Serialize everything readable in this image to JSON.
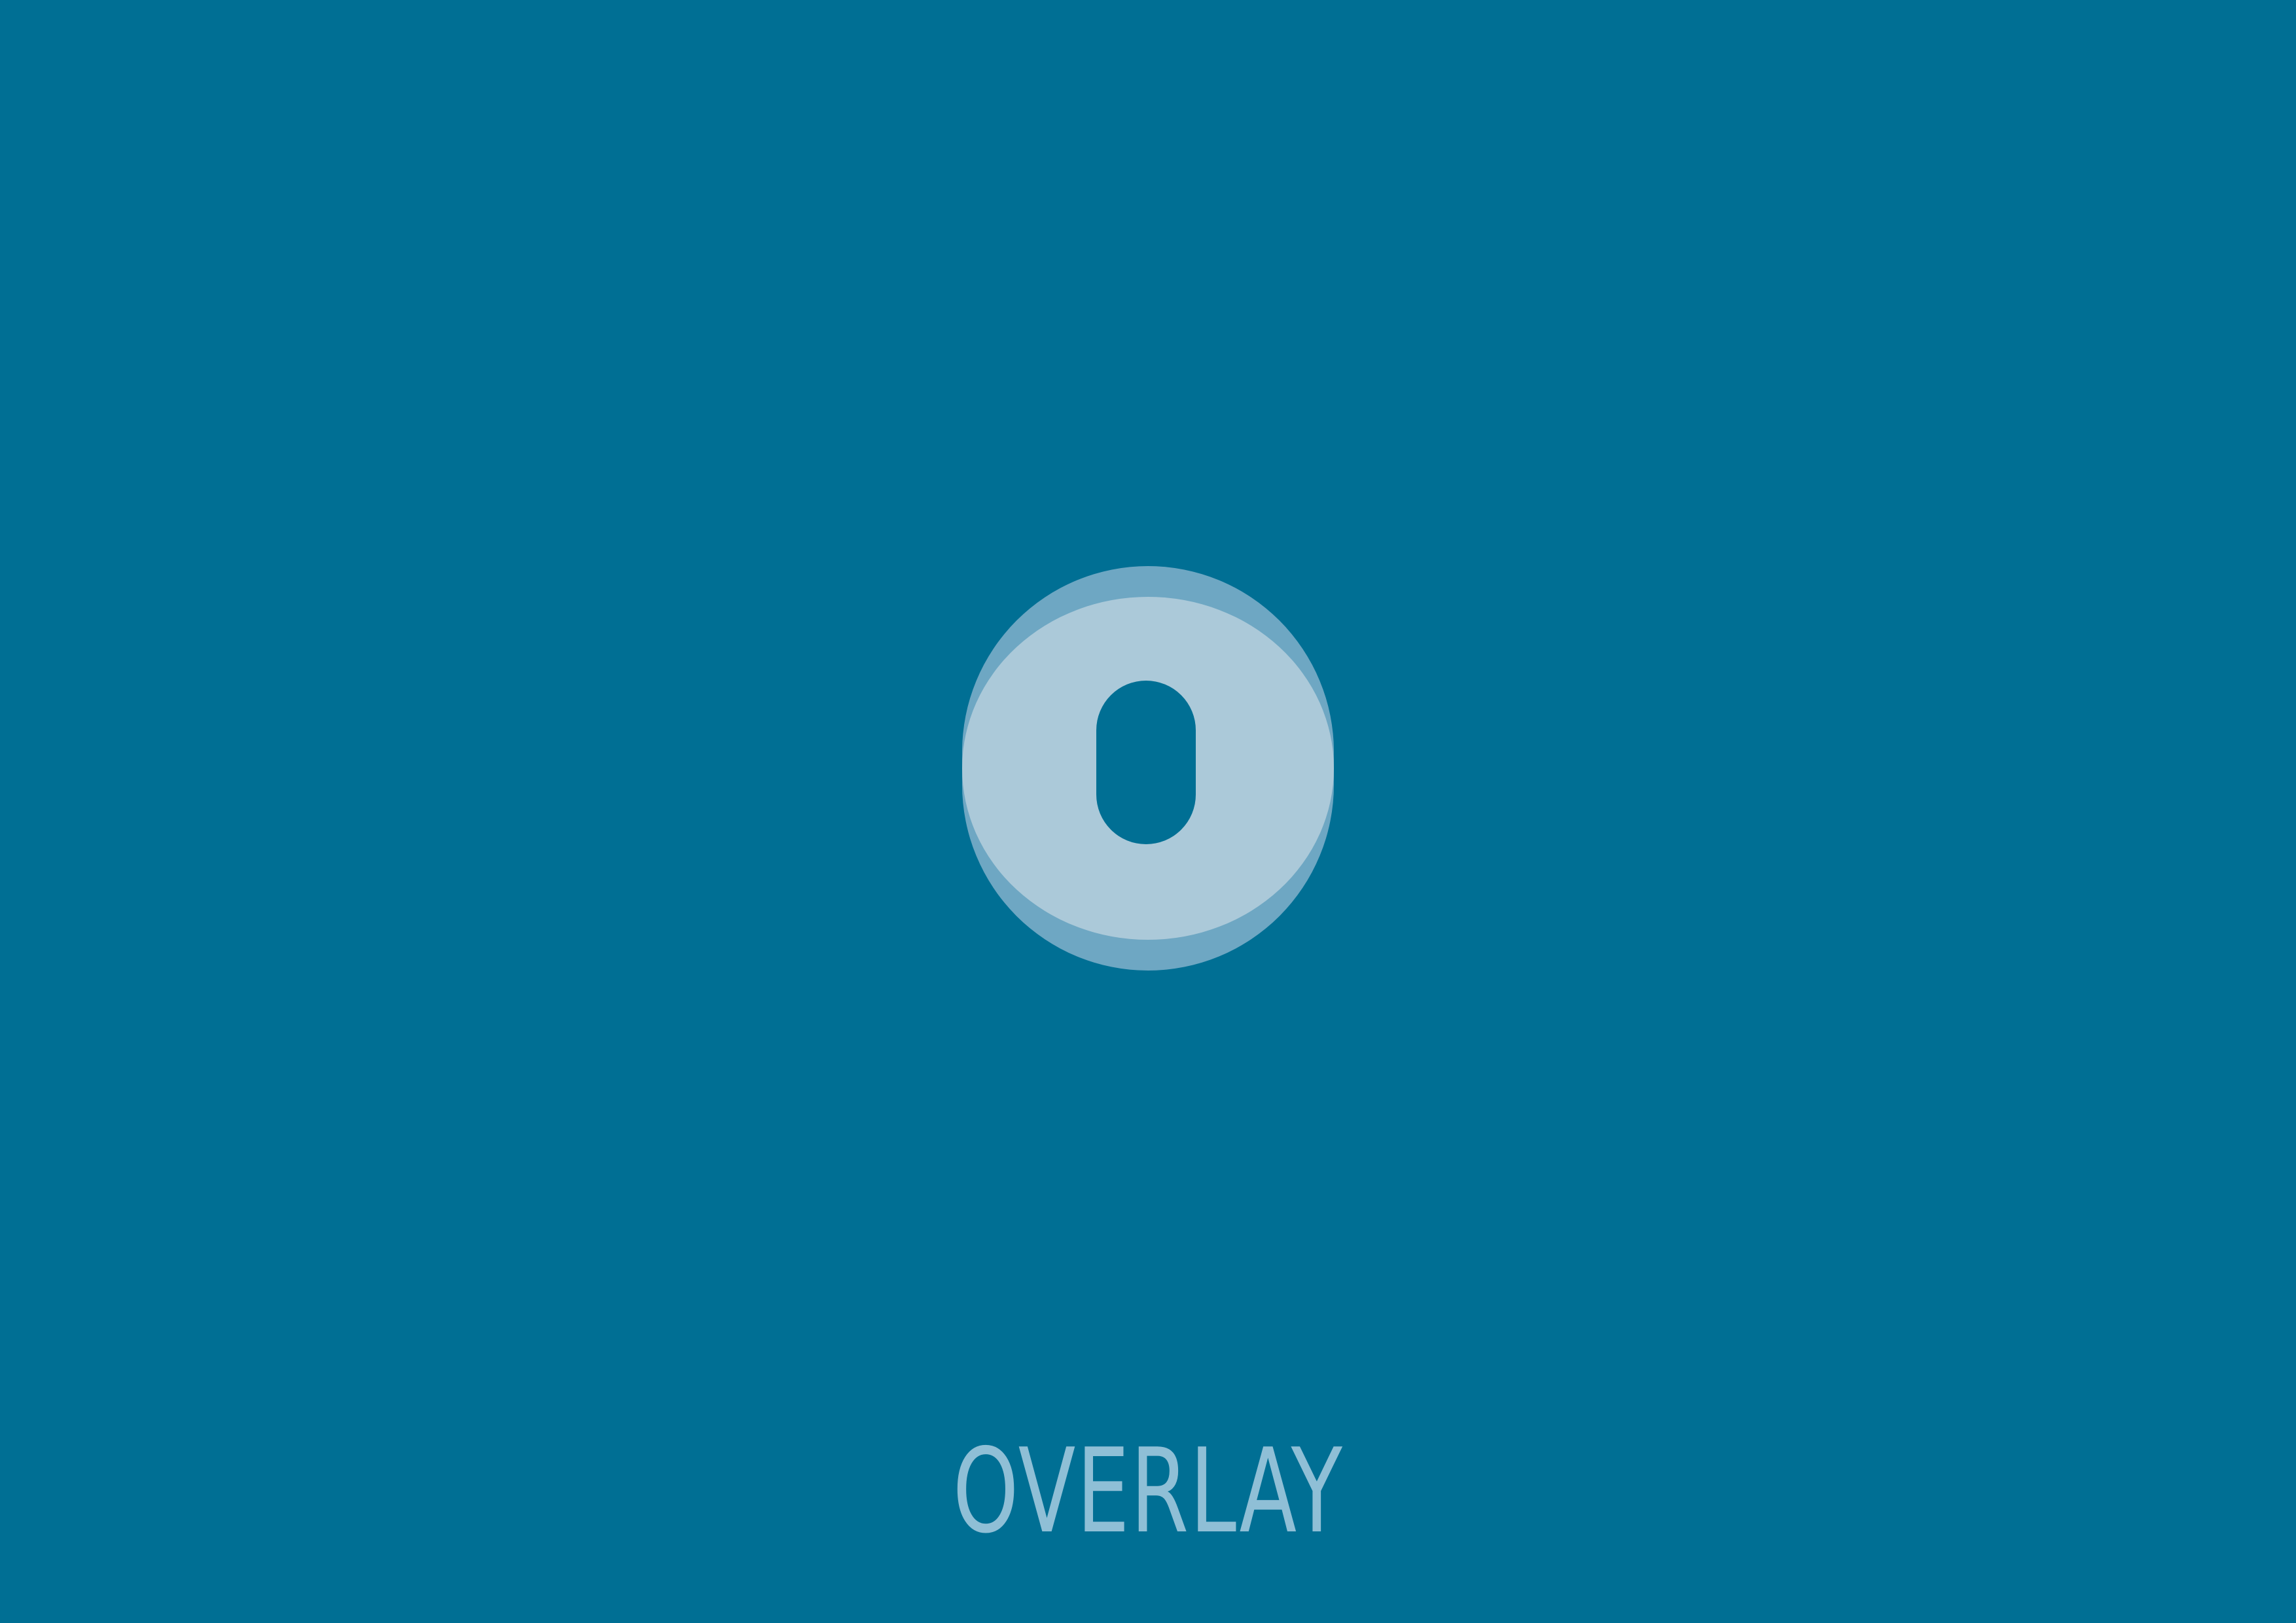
{
  "brand": {
    "name": "OVERLAY",
    "logo": "overlay-logo",
    "colors": {
      "background": "#006f94",
      "outer_disc": "#6ea7c3",
      "inner_disc": "#abc9d9",
      "wordmark": "#8fbfd6"
    }
  }
}
